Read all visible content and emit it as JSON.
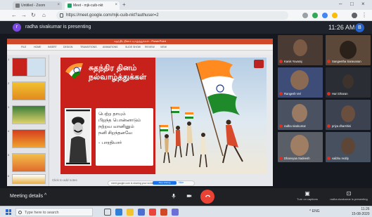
{
  "browser": {
    "tabs": [
      {
        "label": "Untitled - Zoom"
      },
      {
        "label": "Meet - mjk-cuib-nkt"
      }
    ],
    "new_tab": "+",
    "url": "https://meet.google.com/mjk-cuib-nkt?authuser=2"
  },
  "meet": {
    "presenter_initial": "r",
    "presenting_text": "radha sivakumar is presenting",
    "clock": "11:26 AM",
    "user_initial": "B"
  },
  "powerpoint": {
    "title_bar": "சுதந்திர தினம் வாழ்த்துக்கள் - PowerPoint",
    "ribbon_tabs": [
      "FILE",
      "HOME",
      "INSERT",
      "DESIGN",
      "TRANSITIONS",
      "ANIMATIONS",
      "SLIDE SHOW",
      "REVIEW",
      "VIEW"
    ],
    "thumb_numbers": [
      "1",
      "2",
      "3",
      "4",
      "5",
      "6",
      "7",
      "8"
    ],
    "notes_placeholder": "Click to add notes",
    "share_bar": {
      "text": "meet.google.com is sharing your screen.",
      "stop_label": "Stop sharing",
      "hide_label": "Hide"
    }
  },
  "slide": {
    "title_line1": "சுதந்திர தினம்",
    "title_line2": "நல்வாழ்த்துக்கள்",
    "poem_lines": [
      "பெற்ற தாயும்",
      "பிறந்த பொன்னாடும்",
      "நற்றவ வானினும்",
      "நனி சிறந்தனவே"
    ],
    "author": "- பாரதியார்"
  },
  "participants": [
    {
      "name": "Kanis Yuvaraj"
    },
    {
      "name": "Sangeetha Saravanan"
    },
    {
      "name": "Rangesh Vel"
    },
    {
      "name": "Hari Dharan"
    },
    {
      "name": "radha sivakumar"
    },
    {
      "name": "priya dharshini"
    },
    {
      "name": "Dhanvyaa Sadeesh"
    },
    {
      "name": "vaibhu reddy"
    }
  ],
  "controls": {
    "meeting_details": "Meeting details",
    "caret": "^",
    "captions_label": "Turn on captions",
    "presenting_label": "radha sivakumar is presenting"
  },
  "taskbar": {
    "search_placeholder": "Type here to search",
    "tray": "^ ENG",
    "time": "11:26",
    "date": "15-08-2020"
  },
  "colors": {
    "slide_red": "#c8201a",
    "end_call_red": "#ea4335",
    "meet_dark": "#202124",
    "accent_blue": "#1a73e8"
  }
}
